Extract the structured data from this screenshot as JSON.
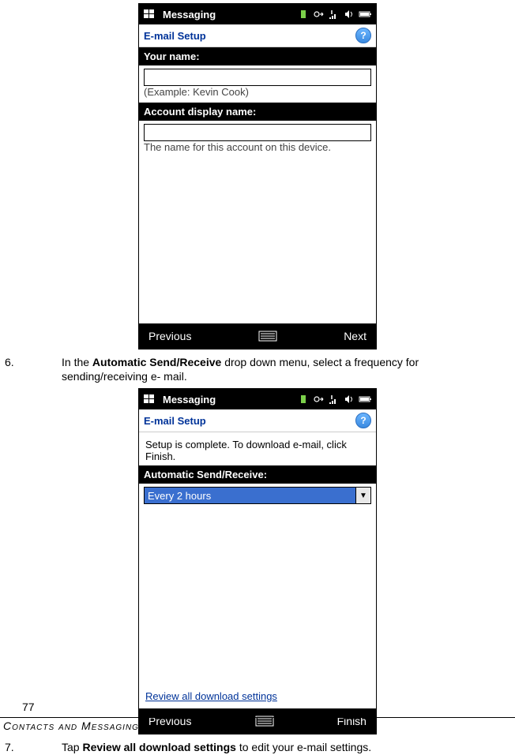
{
  "screen1": {
    "status_app": "Messaging",
    "header": "E-mail Setup",
    "help": "?",
    "your_name_label": "Your name:",
    "your_name_value": "",
    "example_text": "(Example: Kevin Cook)",
    "account_display_label": "Account display name:",
    "account_display_value": "",
    "account_hint": "The name for this account on this device.",
    "prev": "Previous",
    "next": "Next"
  },
  "instruction6": {
    "num": "6.",
    "text_pre": "In the ",
    "bold": "Automatic Send/Receive",
    "text_post": " drop down menu, select a frequency for sending/receiving e- mail."
  },
  "screen2": {
    "status_app": "Messaging",
    "header": "E-mail Setup",
    "help": "?",
    "setup_complete": "Setup is complete.  To download e-mail, click Finish.",
    "auto_label": "Automatic Send/Receive:",
    "auto_value": "Every 2 hours",
    "review_link": "Review all download settings",
    "prev": "Previous",
    "finish": "Finish"
  },
  "instruction7": {
    "num": "7.",
    "text_pre": "Tap ",
    "bold": "Review all download settings",
    "text_post": " to edit your e-mail settings."
  },
  "page_number": "77",
  "footer": "Contacts and Messaging"
}
